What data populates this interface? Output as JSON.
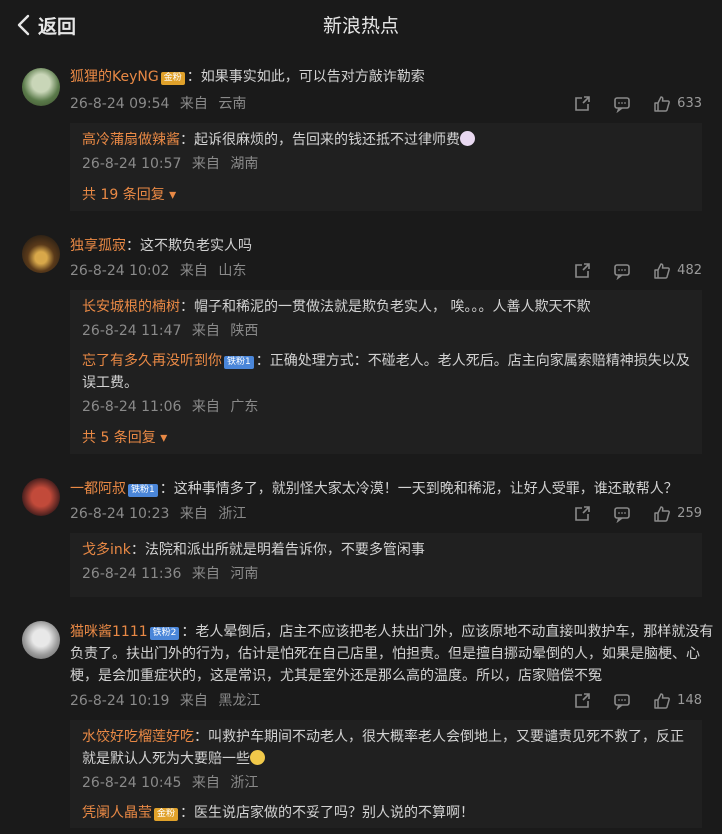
{
  "header": {
    "back_label": "返回",
    "title": "新浪热点"
  },
  "comments": [
    {
      "user": "狐狸的KeyNG",
      "badge": "金粉",
      "badge_color": "#e0a12a",
      "text": "：如果事实如此，可以告对方敲诈勒索",
      "time": "26-8-24 09:54",
      "from": "来自",
      "location": "云南",
      "likes": "633",
      "replies": [
        {
          "user": "高冷蒲扇做辣酱",
          "badge": "",
          "text": "：起诉很麻烦的，告回来的钱还抵不过律师费",
          "time": "26-8-24 10:57",
          "from": "来自",
          "location": "湖南"
        }
      ],
      "more": "共 19 条回复"
    },
    {
      "user": "独享孤寂",
      "badge": "",
      "text": "：这不欺负老实人吗",
      "time": "26-8-24 10:02",
      "from": "来自",
      "location": "山东",
      "likes": "482",
      "replies": [
        {
          "user": "长安城根的楠树",
          "badge": "",
          "text": "：帽子和稀泥的一贯做法就是欺负老实人， 唉。。。人善人欺天不欺",
          "time": "26-8-24 11:47",
          "from": "来自",
          "location": "陕西"
        },
        {
          "user": "忘了有多久再没听到你",
          "badge": "铁粉1",
          "text": "：正确处理方式：不碰老人。老人死后。店主向家属索赔精神损失以及误工费。",
          "time": "26-8-24 11:06",
          "from": "来自",
          "location": "广东"
        }
      ],
      "more": "共 5 条回复"
    },
    {
      "user": "一都阿叔",
      "badge": "铁粉1",
      "text": "：这种事情多了，就别怪大家太冷漠！一天到晚和稀泥，让好人受罪，谁还敢帮人？",
      "time": "26-8-24 10:23",
      "from": "来自",
      "location": "浙江",
      "likes": "259",
      "replies": [
        {
          "user": "戈多ink",
          "badge": "",
          "text": "：法院和派出所就是明着告诉你，不要多管闲事",
          "time": "26-8-24 11:36",
          "from": "来自",
          "location": "河南"
        }
      ],
      "more": ""
    },
    {
      "user": "猫咪酱1111",
      "badge": "铁粉2",
      "text": "：老人晕倒后，店主不应该把老人扶出门外，应该原地不动直接叫救护车，那样就没有负责了。扶出门外的行为，估计是怕死在自己店里，怕担责。但是擅自挪动晕倒的人，如果是脑梗、心梗，是会加重症状的，这是常识，尤其是室外还是那么高的温度。所以，店家赔偿不冤",
      "time": "26-8-24 10:19",
      "from": "来自",
      "location": "黑龙江",
      "likes": "148",
      "replies": [
        {
          "user": "水饺好吃榴莲好吃",
          "badge": "",
          "text": "：叫救护车期间不动老人，很大概率老人会倒地上，又要谴责见死不救了，反正就是默认人死为大要赔一些",
          "time": "26-8-24 10:45",
          "from": "来自",
          "location": "浙江"
        },
        {
          "user": "凭阑人晶莹",
          "badge": "金粉",
          "text": "：医生说店家做的不妥了吗？别人说的不算啊！",
          "time": "",
          "from": "",
          "location": ""
        }
      ],
      "more": ""
    }
  ]
}
